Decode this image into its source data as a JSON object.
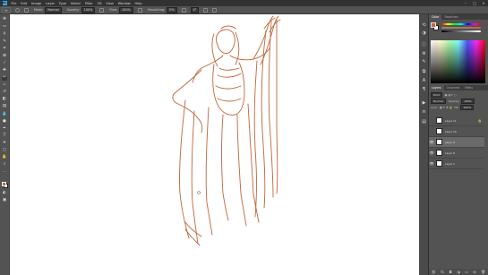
{
  "app": {
    "logo_text": "Ps"
  },
  "menu": [
    "File",
    "Edit",
    "Image",
    "Layer",
    "Type",
    "Select",
    "Filter",
    "3D",
    "View",
    "Window",
    "Help"
  ],
  "window_controls": {
    "minimize": "–",
    "maximize": "□",
    "close": "×"
  },
  "options_bar": {
    "mode_label": "Mode:",
    "mode_value": "Normal",
    "opacity_label": "Opacity:",
    "opacity_value": "100%",
    "flow_label": "Flow:",
    "flow_value": "100%",
    "smoothing_label": "Smoothing:",
    "smoothing_value": "0%",
    "angle_value": "0°"
  },
  "tools": [
    {
      "name": "move-tool",
      "glyph": "✥"
    },
    {
      "name": "artboard-tool",
      "glyph": "▭"
    },
    {
      "name": "lasso-tool",
      "glyph": "ϙ"
    },
    {
      "name": "quick-select-tool",
      "glyph": "✎"
    },
    {
      "name": "crop-tool",
      "glyph": "⌗"
    },
    {
      "name": "frame-tool",
      "glyph": "⊠"
    },
    {
      "name": "eyedropper-tool",
      "glyph": "⁄"
    },
    {
      "name": "healing-tool",
      "glyph": "✚"
    },
    {
      "name": "brush-tool",
      "glyph": "✏"
    },
    {
      "name": "stamp-tool",
      "glyph": "⊥"
    },
    {
      "name": "history-brush-tool",
      "glyph": "↺"
    },
    {
      "name": "eraser-tool",
      "glyph": "◧"
    },
    {
      "name": "gradient-tool",
      "glyph": "▤"
    },
    {
      "name": "blur-tool",
      "glyph": "💧"
    },
    {
      "name": "dodge-tool",
      "glyph": "●"
    },
    {
      "name": "pen-tool",
      "glyph": "✒"
    },
    {
      "name": "type-tool",
      "glyph": "T"
    },
    {
      "name": "path-select-tool",
      "glyph": "➤"
    },
    {
      "name": "shape-tool",
      "glyph": "▢"
    },
    {
      "name": "hand-tool",
      "glyph": "✋"
    },
    {
      "name": "zoom-tool",
      "glyph": "⌕"
    },
    {
      "name": "more-tools",
      "glyph": "…"
    }
  ],
  "extra_tools": [
    {
      "name": "quick-mask-button",
      "glyph": "◐"
    },
    {
      "name": "screen-mode-button",
      "glyph": "▣"
    }
  ],
  "colors": {
    "foreground": "#c8663a",
    "background": "#ffffff",
    "stroke": "#c0653a"
  },
  "dock_icons": [
    "history-icon",
    "adjust-icon",
    "info-icon",
    "gear-icon",
    "brush-settings-icon",
    "clone-source-icon",
    "character-icon",
    "paragraph-icon",
    "play-icon",
    "properties-icon",
    "libraries-icon"
  ],
  "color_panel": {
    "tabs": [
      "Color",
      "Swatches"
    ]
  },
  "layers_panel": {
    "tabs": [
      "Layers",
      "Channels",
      "Paths"
    ],
    "kind_label": "Kind",
    "blend_mode": "Normal",
    "opacity_label": "Opacity:",
    "opacity_value": "100%",
    "lock_label": "Lock:",
    "fill_label": "Fill:",
    "fill_value": "100%",
    "layers": [
      {
        "name": "Layer 11",
        "visible": false,
        "selected": false,
        "locked": true
      },
      {
        "name": "Layer 10",
        "visible": false,
        "selected": false,
        "locked": false
      },
      {
        "name": "Layer 9",
        "visible": true,
        "selected": true,
        "locked": false
      },
      {
        "name": "Layer 8",
        "visible": true,
        "selected": false,
        "locked": false
      },
      {
        "name": "Layer 1",
        "visible": true,
        "selected": false,
        "locked": false
      }
    ],
    "footer_icons": [
      "link-icon",
      "fx-icon",
      "mask-icon",
      "adjustment-icon",
      "group-icon",
      "new-layer-icon",
      "trash-icon"
    ]
  }
}
